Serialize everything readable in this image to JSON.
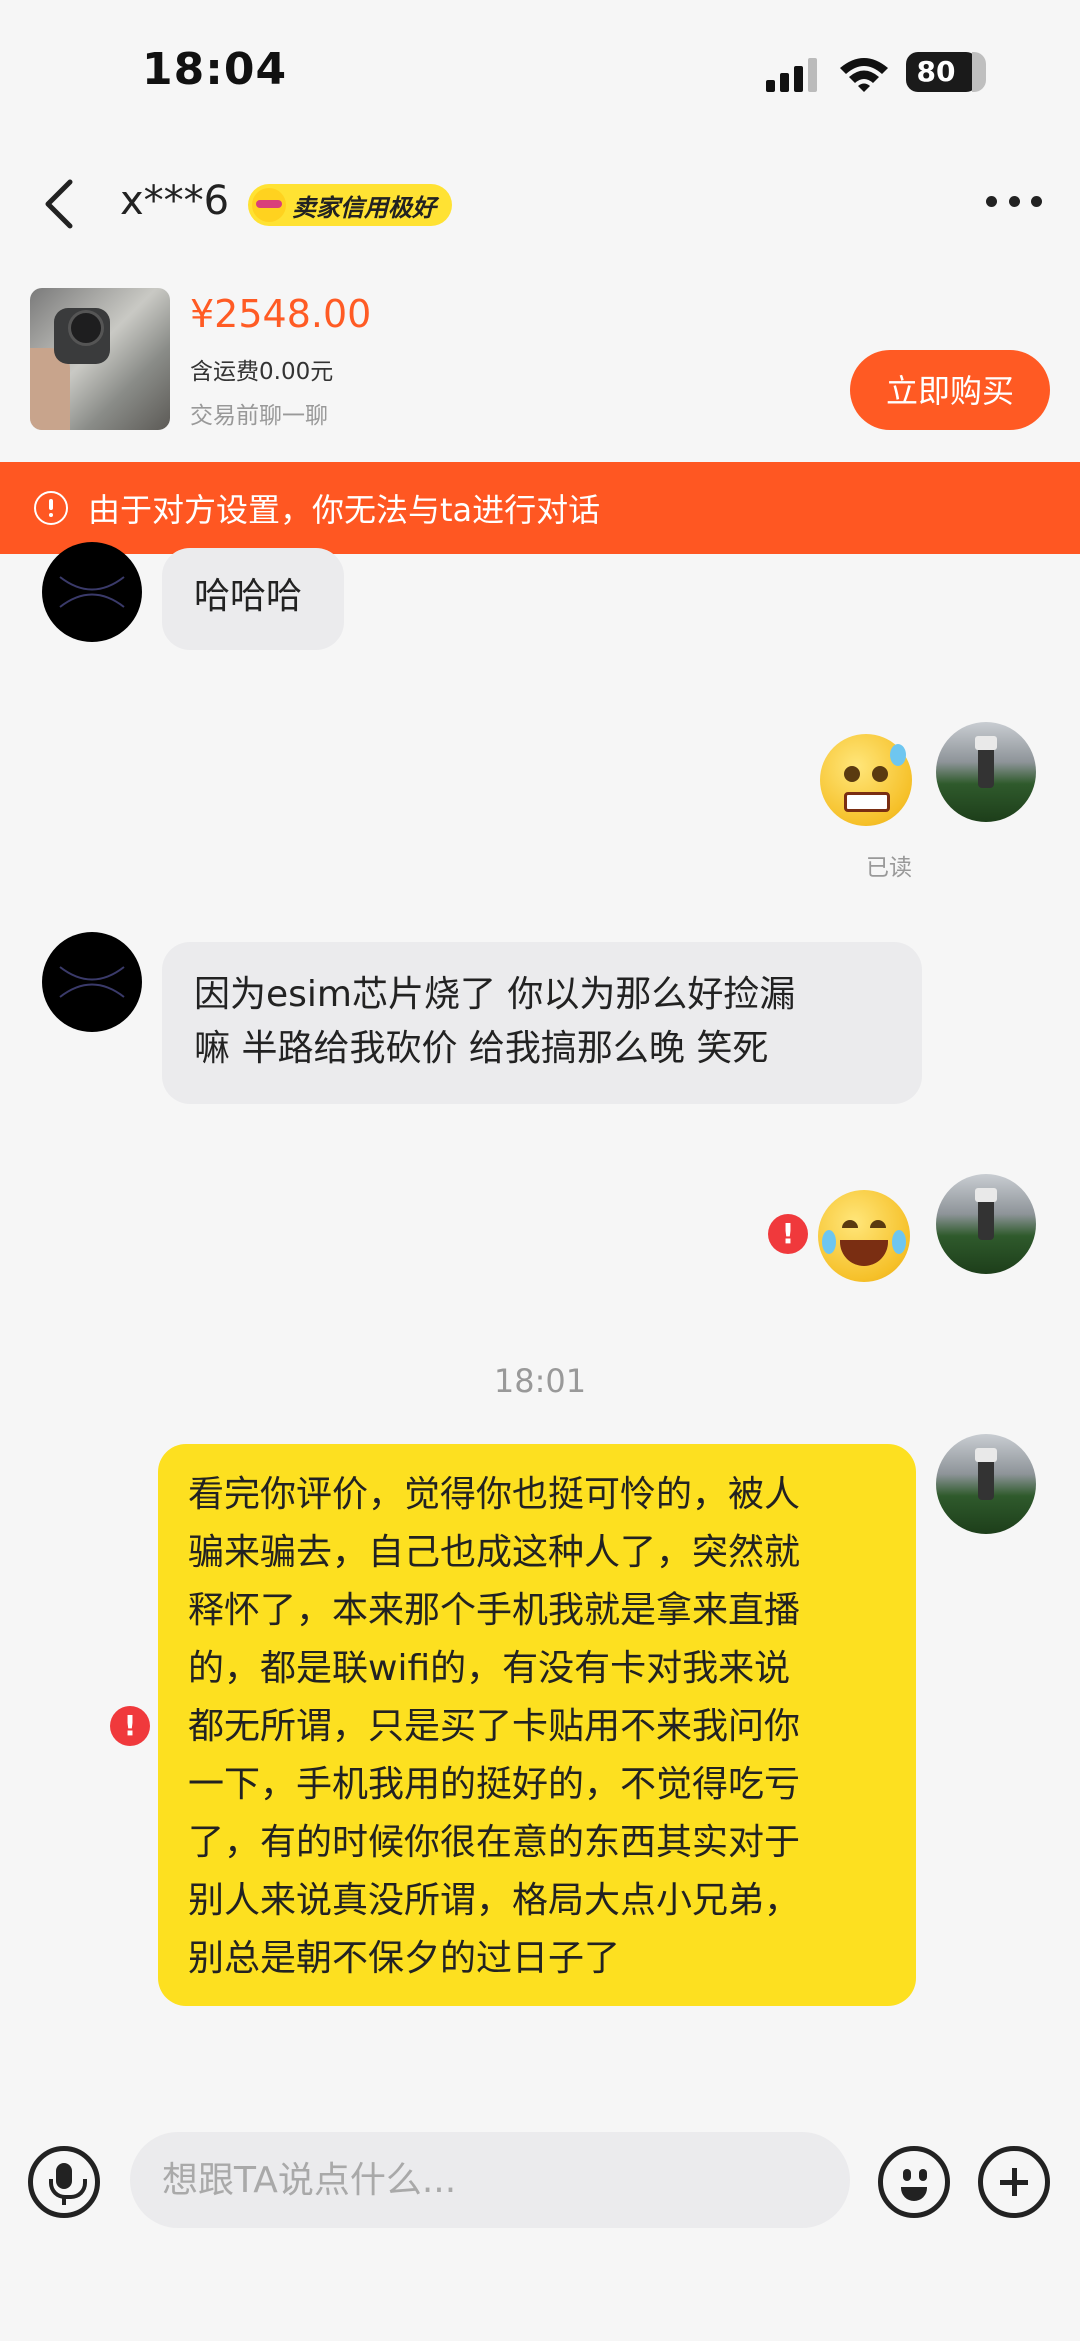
{
  "status_bar": {
    "time": "18:04",
    "battery": "80"
  },
  "header": {
    "username": "x***6",
    "badge": "卖家信用极好"
  },
  "product": {
    "price": "¥2548.00",
    "shipping": "含运费0.00元",
    "hint": "交易前聊一聊",
    "buy_label": "立即购买"
  },
  "banner": {
    "text": "由于对方设置，你无法与ta进行对话"
  },
  "messages": {
    "m1": "哈哈哈",
    "read": "已读",
    "m2_line1": "因为esim芯片烧了 你以为那么好捡漏",
    "m2_line2": "嘛 半路给我砍价 给我搞那么晚 笑死",
    "timestamp": "18:01",
    "long_lines": [
      "看完你评价，觉得你也挺可怜的，被人",
      "骗来骗去，自己也成这种人了，突然就",
      "释怀了，本来那个手机我就是拿来直播",
      "的，都是联wifi的，有没有卡对我来说",
      "都无所谓，只是买了卡贴用不来我问你",
      "一下，手机我用的挺好的，不觉得吃亏",
      "了，有的时候你很在意的东西其实对于",
      "别人来说真没所谓，格局大点小兄弟，",
      "别总是朝不保夕的过日子了"
    ],
    "error_mark": "!"
  },
  "input_bar": {
    "placeholder": "想跟TA说点什么..."
  },
  "colors": {
    "accent": "#ff5a23",
    "bubble_self": "#fde020",
    "banner": "#ff5722"
  },
  "icons": [
    "back-arrow-icon",
    "more-icon",
    "warning-icon",
    "mic-icon",
    "emoji-icon",
    "plus-icon",
    "error-icon"
  ]
}
